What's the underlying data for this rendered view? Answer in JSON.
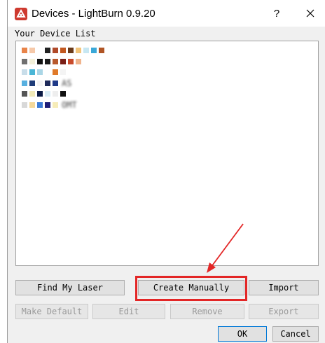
{
  "window": {
    "title": "Devices - LightBurn 0.9.20",
    "help": "?",
    "close_icon": "close-icon"
  },
  "device_list": {
    "label": "Your Device List",
    "rows": [
      {
        "pixels": [
          "#e8844a",
          "#f6c9a9",
          "#ffffff",
          "#222222",
          "#b04a2a",
          "#c2581f",
          "#6b3b1a",
          "#f3c57a",
          "#c7e7f2",
          "#3aa8d8",
          "#b05525"
        ],
        "text": ""
      },
      {
        "pixels": [
          "#707070",
          "#f3f0d9",
          "#111111",
          "#1a1a1a",
          "#b85a2e",
          "#7a1f17",
          "#c84a2b",
          "#f0b48c"
        ],
        "text": ""
      },
      {
        "pixels": [
          "#c8dde9",
          "#4ab6d6",
          "#aad6e6",
          "#ffffff",
          "#e07a2a",
          "#f4f4f4"
        ],
        "text": ""
      },
      {
        "pixels": [
          "#58b0e0",
          "#1e3c78",
          "#f4f4f4",
          "#1e2a5a",
          "#203a88"
        ],
        "text": "AS"
      },
      {
        "pixels": [
          "#555555",
          "#f0e9b8",
          "#0a1a44",
          "#d9ecf5",
          "#eeeeee",
          "#111111"
        ],
        "text": ""
      },
      {
        "pixels": [
          "#d8d8d8",
          "#f4d89a",
          "#3b7bd6",
          "#1e1e78",
          "#f6ecb8"
        ],
        "text": "OMT"
      }
    ]
  },
  "buttons": {
    "find_laser": "Find My Laser",
    "create_manually": "Create Manually",
    "import": "Import",
    "make_default": "Make Default",
    "edit": "Edit",
    "remove": "Remove",
    "export": "Export",
    "ok": "OK",
    "cancel": "Cancel"
  },
  "colors": {
    "annotation": "#e32626",
    "accent": "#0078d7",
    "app_icon": "#ce3a2f"
  }
}
